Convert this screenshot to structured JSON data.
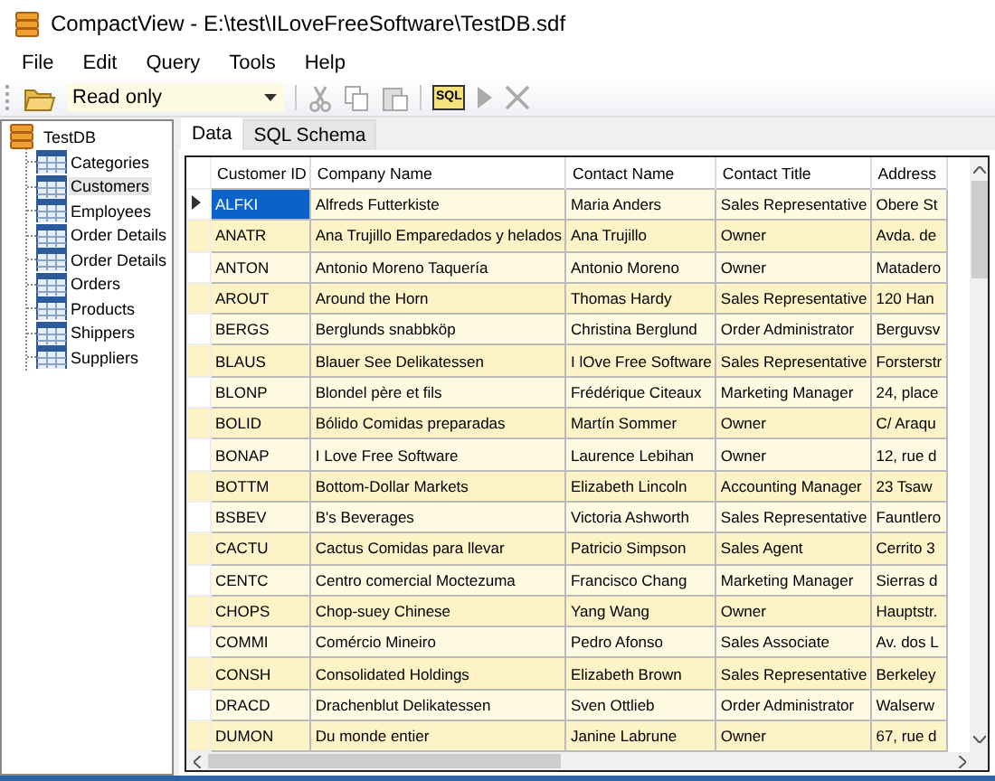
{
  "window": {
    "title": "CompactView - E:\\test\\ILoveFreeSoftware\\TestDB.sdf"
  },
  "menu": [
    "File",
    "Edit",
    "Query",
    "Tools",
    "Help"
  ],
  "toolbar": {
    "mode": {
      "value": "Read only"
    },
    "buttons": [
      {
        "kind": "cut",
        "disabled": true
      },
      {
        "kind": "copy",
        "disabled": true
      },
      {
        "kind": "paste",
        "disabled": true
      },
      {
        "kind": "sql",
        "label": "SQL",
        "disabled": false
      },
      {
        "kind": "run",
        "disabled": true
      },
      {
        "kind": "cancel",
        "disabled": true
      }
    ]
  },
  "tree": {
    "label": "TestDB",
    "children": [
      {
        "label": "Categories",
        "selected": false
      },
      {
        "label": "Customers",
        "selected": true
      },
      {
        "label": "Employees",
        "selected": false
      },
      {
        "label": "Order Details",
        "selected": false
      },
      {
        "label": "Order Details",
        "selected": false
      },
      {
        "label": "Orders",
        "selected": false
      },
      {
        "label": "Products",
        "selected": false
      },
      {
        "label": "Shippers",
        "selected": false
      },
      {
        "label": "Suppliers",
        "selected": false
      }
    ]
  },
  "tabs": [
    {
      "label": "Data",
      "selected": true
    },
    {
      "label": "SQL Schema",
      "selected": false
    }
  ],
  "table": {
    "columns": [
      "Customer ID",
      "Company Name",
      "Contact Name",
      "Contact Title",
      "Address"
    ],
    "rows": [
      {
        "selected": true,
        "cells": [
          "ALFKI",
          "Alfreds Futterkiste",
          "Maria Anders",
          "Sales Representative",
          "Obere St"
        ]
      },
      {
        "selected": false,
        "cells": [
          "ANATR",
          "Ana Trujillo Emparedados y helados",
          "Ana Trujillo",
          "Owner",
          "Avda. de"
        ]
      },
      {
        "selected": false,
        "cells": [
          "ANTON",
          "Antonio Moreno Taquería",
          "Antonio Moreno",
          "Owner",
          "Matadero"
        ]
      },
      {
        "selected": false,
        "cells": [
          "AROUT",
          "Around the Horn",
          "Thomas Hardy",
          "Sales Representative",
          "120 Han"
        ]
      },
      {
        "selected": false,
        "cells": [
          "BERGS",
          "Berglunds snabbköp",
          "Christina Berglund",
          "Order Administrator",
          "Berguvsv"
        ]
      },
      {
        "selected": false,
        "cells": [
          "BLAUS",
          "Blauer See Delikatessen",
          "I lOve Free Software",
          "Sales Representative",
          "Forsterstr"
        ]
      },
      {
        "selected": false,
        "cells": [
          "BLONP",
          "Blondel père et fils",
          "Frédérique Citeaux",
          "Marketing Manager",
          "24, place"
        ]
      },
      {
        "selected": false,
        "cells": [
          "BOLID",
          "Bólido Comidas preparadas",
          "Martín Sommer",
          "Owner",
          "C/ Araqu"
        ]
      },
      {
        "selected": false,
        "cells": [
          "BONAP",
          "I Love Free Software",
          "Laurence Lebihan",
          "Owner",
          "12, rue d"
        ]
      },
      {
        "selected": false,
        "cells": [
          "BOTTM",
          "Bottom-Dollar Markets",
          "Elizabeth Lincoln",
          "Accounting Manager",
          "23 Tsaw"
        ]
      },
      {
        "selected": false,
        "cells": [
          "BSBEV",
          "B's Beverages",
          "Victoria Ashworth",
          "Sales Representative",
          "Fauntlero"
        ]
      },
      {
        "selected": false,
        "cells": [
          "CACTU",
          "Cactus Comidas para llevar",
          "Patricio Simpson",
          "Sales Agent",
          "Cerrito 3"
        ]
      },
      {
        "selected": false,
        "cells": [
          "CENTC",
          "Centro comercial Moctezuma",
          "Francisco Chang",
          "Marketing Manager",
          "Sierras d"
        ]
      },
      {
        "selected": false,
        "cells": [
          "CHOPS",
          "Chop-suey Chinese",
          "Yang Wang",
          "Owner",
          "Hauptstr."
        ]
      },
      {
        "selected": false,
        "cells": [
          "COMMI",
          "Comércio Mineiro",
          "Pedro Afonso",
          "Sales Associate",
          "Av. dos L"
        ]
      },
      {
        "selected": false,
        "cells": [
          "CONSH",
          "Consolidated Holdings",
          "Elizabeth Brown",
          "Sales Representative",
          "Berkeley"
        ]
      },
      {
        "selected": false,
        "cells": [
          "DRACD",
          "Drachenblut Delikatessen",
          "Sven Ottlieb",
          "Order Administrator",
          "Walserw"
        ]
      },
      {
        "selected": false,
        "cells": [
          "DUMON",
          "Du monde entier",
          "Janine Labrune",
          "Owner",
          "67, rue d"
        ]
      }
    ]
  }
}
